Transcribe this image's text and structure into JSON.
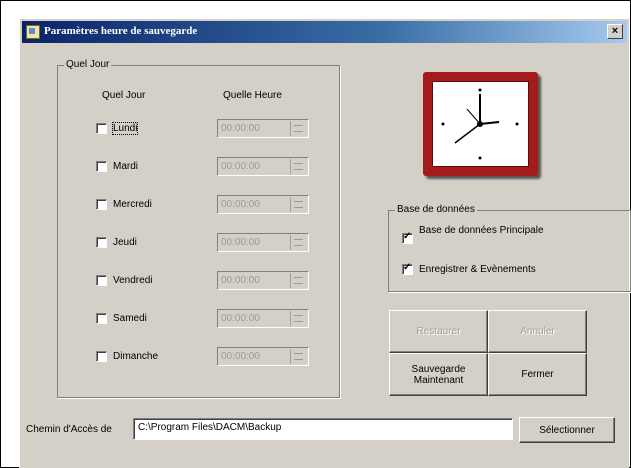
{
  "window": {
    "title": "Paramètres heure de sauvegarde",
    "close_glyph": "×"
  },
  "schedule": {
    "group_title": "Quel Jour",
    "col_day": "Quel Jour",
    "col_time": "Quelle Heure",
    "days": [
      {
        "label": "Lundi",
        "checked": false,
        "time": "00:00:00"
      },
      {
        "label": "Mardi",
        "checked": false,
        "time": "00:00:00"
      },
      {
        "label": "Mercredi",
        "checked": false,
        "time": "00:00:00"
      },
      {
        "label": "Jeudi",
        "checked": false,
        "time": "00:00:00"
      },
      {
        "label": "Vendredi",
        "checked": false,
        "time": "00:00:00"
      },
      {
        "label": "Samedi",
        "checked": false,
        "time": "00:00:00"
      },
      {
        "label": "Dimanche",
        "checked": false,
        "time": "00:00:00"
      }
    ]
  },
  "database": {
    "group_title": "Base de données",
    "options": [
      {
        "label": "Base de données Principale",
        "checked": true
      },
      {
        "label": "Enregistrer & Evènements",
        "checked": true
      }
    ]
  },
  "buttons": {
    "restore": "Restaurer",
    "cancel": "Annuler",
    "backup_now": "Sauvegarde Maintenant",
    "close": "Fermer",
    "select": "Sélectionner"
  },
  "path": {
    "label": "Chemin d'Accès de",
    "value": "C:\\Program Files\\DACM\\Backup"
  },
  "colors": {
    "clock_frame": "#a31b1b",
    "title_bar": "#0a246a"
  },
  "icons": [
    "app-icon",
    "clock-icon",
    "close-icon"
  ]
}
